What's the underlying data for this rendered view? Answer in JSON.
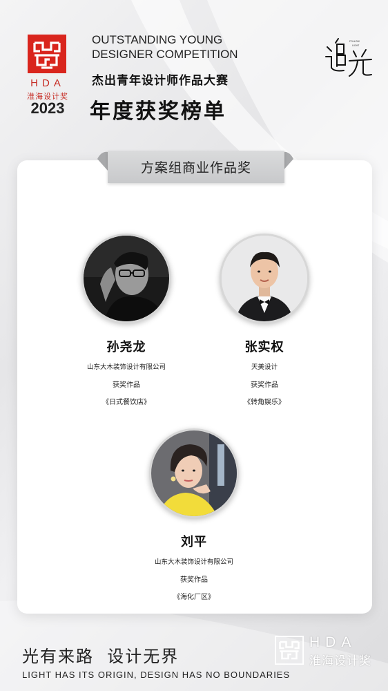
{
  "header": {
    "logo_letters": "HDA",
    "logo_cn": "淮海设计奖",
    "year": "2023",
    "title_en_line1": "OUTSTANDING YOUNG",
    "title_en_line2": "DESIGNER COMPETITION",
    "subtitle_cn": "杰出青年设计师作品大赛",
    "title_cn": "年度获奖榜单",
    "brand_glyph": "追光",
    "brand_small_line1": "FOLLOW",
    "brand_small_line2": "LIGHT"
  },
  "award": {
    "category": "方案组商业作品奖"
  },
  "winners": [
    {
      "name": "孙尧龙",
      "company": "山东大木装饰设计有限公司",
      "label": "获奖作品",
      "work": "《日式餐饮店》",
      "photo": "portrait-bw"
    },
    {
      "name": "张实权",
      "company": "天美设计",
      "label": "获奖作品",
      "work": "《转角娱乐》",
      "photo": "portrait-tuxedo"
    },
    {
      "name": "刘平",
      "company": "山东大木装饰设计有限公司",
      "label": "获奖作品",
      "work": "《海化厂区》",
      "photo": "portrait-yellow"
    }
  ],
  "footer": {
    "slogan_cn": "光有来路  设计无界",
    "slogan_en": "LIGHT HAS ITS ORIGIN, DESIGN HAS NO BOUNDARIES",
    "logo_letters": "HDA",
    "logo_cn": "淮海设计奖"
  },
  "colors": {
    "brand_red": "#d9251d",
    "ribbon": "#cfd0d2",
    "card": "#ffffff"
  }
}
